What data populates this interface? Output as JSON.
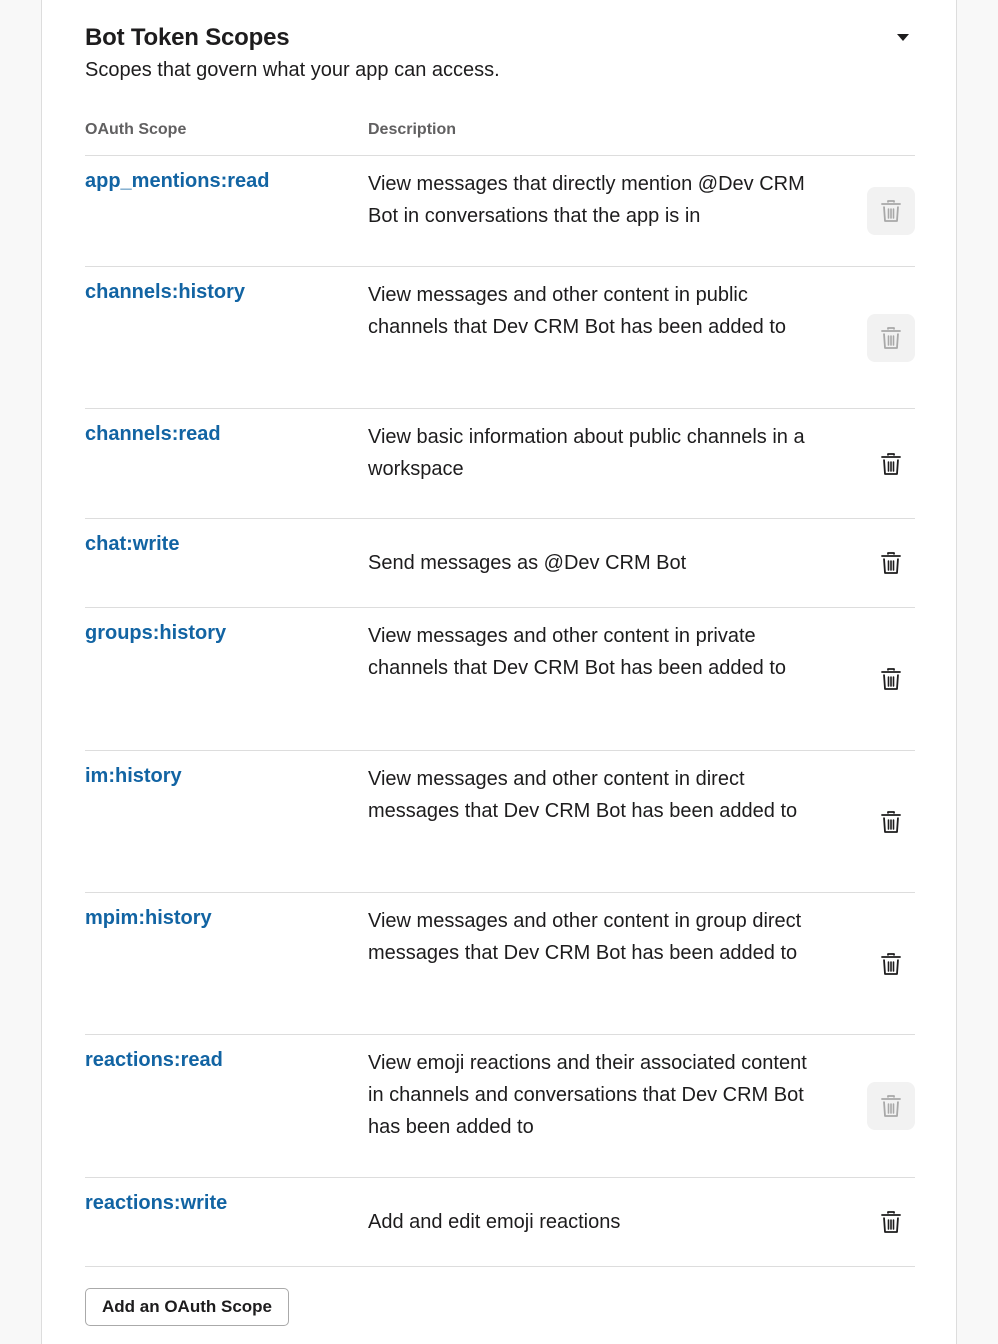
{
  "section": {
    "title": "Bot Token Scopes",
    "subtitle": "Scopes that govern what your app can access.",
    "toggle_icon": "caret-down-icon"
  },
  "table": {
    "headers": {
      "scope": "OAuth Scope",
      "description": "Description"
    },
    "rows": [
      {
        "scope": "app_mentions:read",
        "description": "View messages that directly mention @Dev CRM Bot in conversations that the app is in",
        "delete_disabled": true
      },
      {
        "scope": "channels:history",
        "description": "View messages and other content in public channels that Dev CRM Bot has been added to",
        "delete_disabled": true
      },
      {
        "scope": "channels:read",
        "description": "View basic information about public channels in a workspace",
        "delete_disabled": false
      },
      {
        "scope": "chat:write",
        "description": "Send messages as @Dev CRM Bot",
        "delete_disabled": false
      },
      {
        "scope": "groups:history",
        "description": "View messages and other content in private channels that Dev CRM Bot has been added to",
        "delete_disabled": false
      },
      {
        "scope": "im:history",
        "description": "View messages and other content in direct messages that Dev CRM Bot has been added to",
        "delete_disabled": false
      },
      {
        "scope": "mpim:history",
        "description": "View messages and other content in group direct messages that Dev CRM Bot has been added to",
        "delete_disabled": false
      },
      {
        "scope": "reactions:read",
        "description": "View emoji reactions and their associated content in channels and conversations that Dev CRM Bot has been added to",
        "delete_disabled": true
      },
      {
        "scope": "reactions:write",
        "description": "Add and edit emoji reactions",
        "delete_disabled": false
      }
    ],
    "delete_icon": "trash-icon"
  },
  "actions": {
    "add_scope_label": "Add an OAuth Scope"
  },
  "colors": {
    "link": "#1264a3",
    "text": "#1d1c1d",
    "muted": "#616061",
    "divider": "#dddddd",
    "disabled_bg": "#f2f2f2"
  }
}
